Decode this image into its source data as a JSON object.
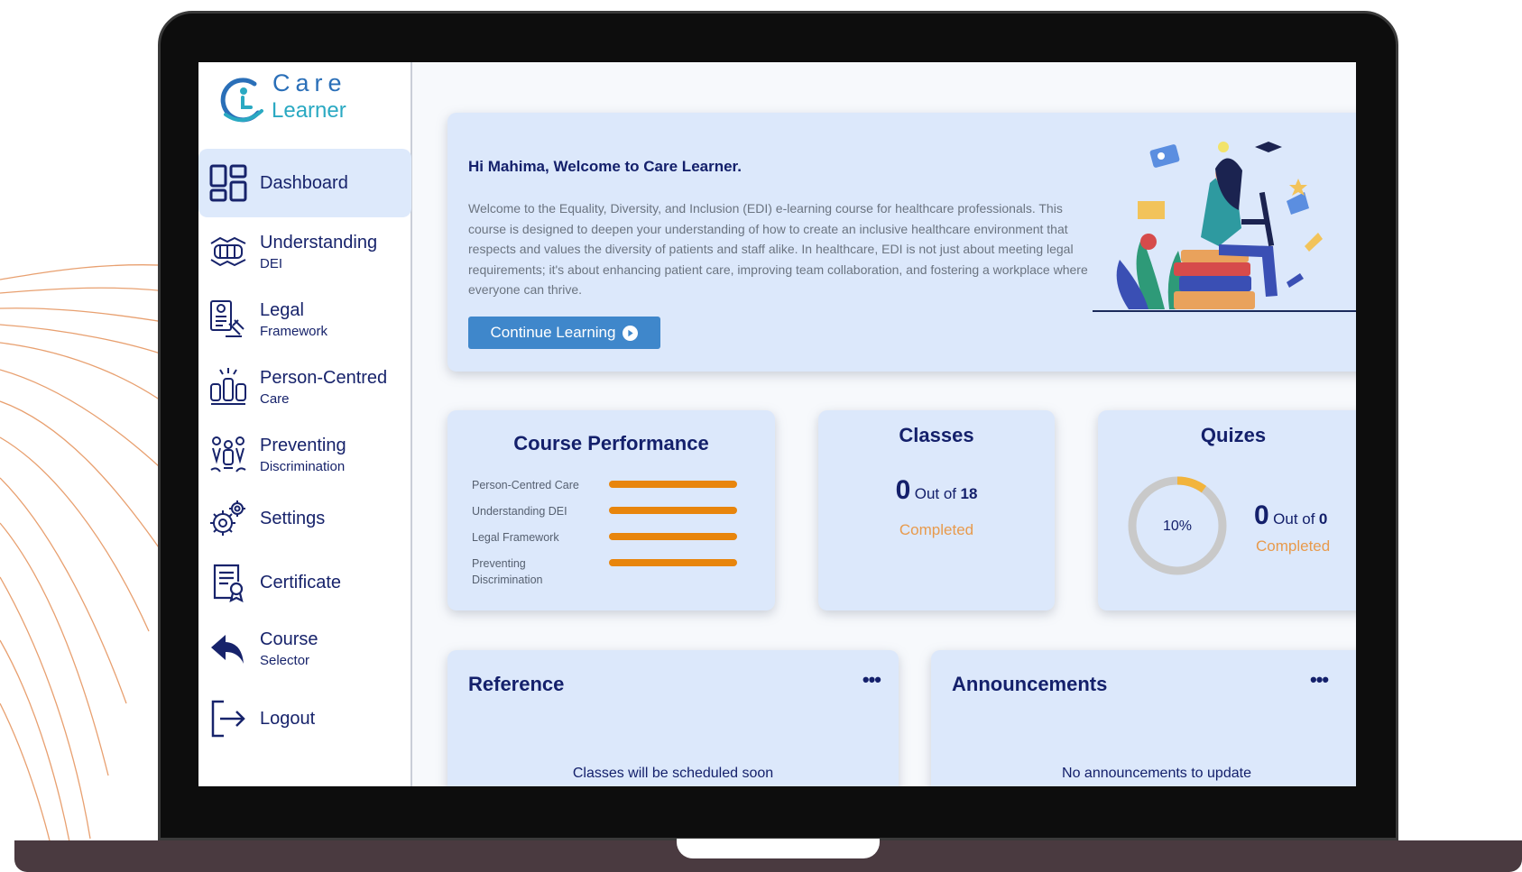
{
  "logo": {
    "line1": "Care",
    "line2": "Learner"
  },
  "sidebar": {
    "items": [
      {
        "label": "Dashboard",
        "sub": "",
        "icon": "dashboard-icon"
      },
      {
        "label": "Understanding",
        "sub": "DEI",
        "icon": "hands-icon"
      },
      {
        "label": "Legal",
        "sub": "Framework",
        "icon": "gavel-document-icon"
      },
      {
        "label": "Person-Centred",
        "sub": "Care",
        "icon": "raised-hands-icon"
      },
      {
        "label": "Preventing",
        "sub": "Discrimination",
        "icon": "people-icon"
      },
      {
        "label": "Settings",
        "sub": "",
        "icon": "gear-icon"
      },
      {
        "label": "Certificate",
        "sub": "",
        "icon": "certificate-icon"
      },
      {
        "label": "Course",
        "sub": "Selector",
        "icon": "back-arrow-icon"
      },
      {
        "label": "Logout",
        "sub": "",
        "icon": "logout-icon"
      }
    ]
  },
  "welcome": {
    "title": "Hi Mahima, Welcome to Care Learner.",
    "body": "Welcome to the Equality, Diversity, and Inclusion (EDI) e-learning course for healthcare professionals. This course is designed to deepen your understanding of how to create an inclusive healthcare environment that respects and values the diversity of patients and staff alike. In healthcare, EDI is not just about meeting legal requirements; it's about enhancing patient care, improving team collaboration, and fostering a workplace where everyone can thrive.",
    "button": "Continue Learning"
  },
  "performance": {
    "title": "Course Performance",
    "rows": [
      {
        "label": "Person-Centred Care"
      },
      {
        "label": "Understanding DEI"
      },
      {
        "label": "Legal Framework"
      },
      {
        "label": "Preventing Discrimination"
      }
    ]
  },
  "classes": {
    "title": "Classes",
    "count": "0",
    "out_of": "Out of",
    "total": "18",
    "status": "Completed"
  },
  "quizes": {
    "title": "Quizes",
    "percent_label": "10%",
    "percent": 10,
    "count": "0",
    "out_of": "Out of",
    "total": "0",
    "status": "Completed"
  },
  "reference": {
    "title": "Reference",
    "menu": "•••",
    "message": "Classes will be scheduled soon"
  },
  "announcements": {
    "title": "Announcements",
    "menu": "•••",
    "message": "No announcements to update"
  },
  "colors": {
    "accent": "#3f87cb",
    "progress": "#e8850c",
    "card": "#dce8fb",
    "navy": "#14206b"
  }
}
